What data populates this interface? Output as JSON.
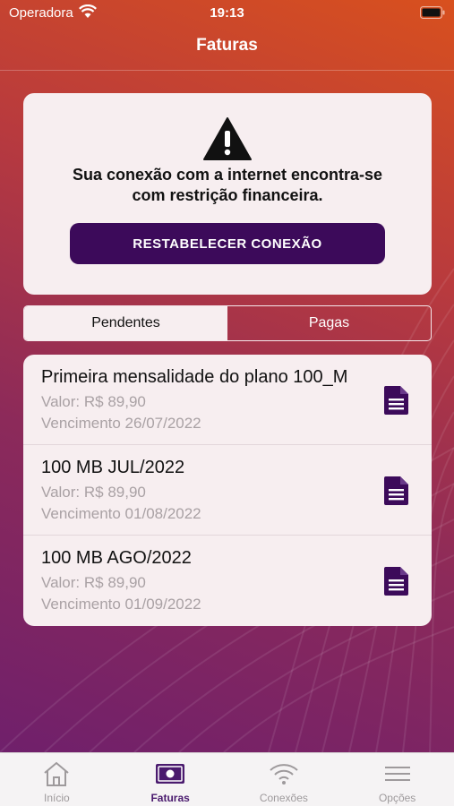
{
  "status_bar": {
    "carrier": "Operadora",
    "time": "19:13"
  },
  "nav": {
    "title": "Faturas"
  },
  "alert": {
    "message_line1": "Sua conexão com a internet encontra-se",
    "message_line2": "com restrição financeira.",
    "button_label": "RESTABELECER CONEXÃO"
  },
  "segments": [
    {
      "label": "Pendentes",
      "selected": true
    },
    {
      "label": "Pagas",
      "selected": false
    }
  ],
  "invoices": [
    {
      "title": "Primeira mensalidade do plano 100_M",
      "value": "Valor: R$ 89,90",
      "due": "Vencimento 26/07/2022"
    },
    {
      "title": "100 MB JUL/2022",
      "value": "Valor: R$ 89,90",
      "due": "Vencimento 01/08/2022"
    },
    {
      "title": "100 MB AGO/2022",
      "value": "Valor: R$ 89,90",
      "due": "Vencimento 01/09/2022"
    }
  ],
  "tabs": [
    {
      "label": "Início",
      "icon": "home-icon",
      "active": false
    },
    {
      "label": "Faturas",
      "icon": "invoice-icon",
      "active": true
    },
    {
      "label": "Conexões",
      "icon": "wifi-icon",
      "active": false
    },
    {
      "label": "Opções",
      "icon": "menu-icon",
      "active": false
    }
  ],
  "colors": {
    "primary": "#3c0a5a",
    "card_background": "#f7eef0",
    "active_tab": "#4a1a6e",
    "secondary_text": "#a9a1a4"
  }
}
